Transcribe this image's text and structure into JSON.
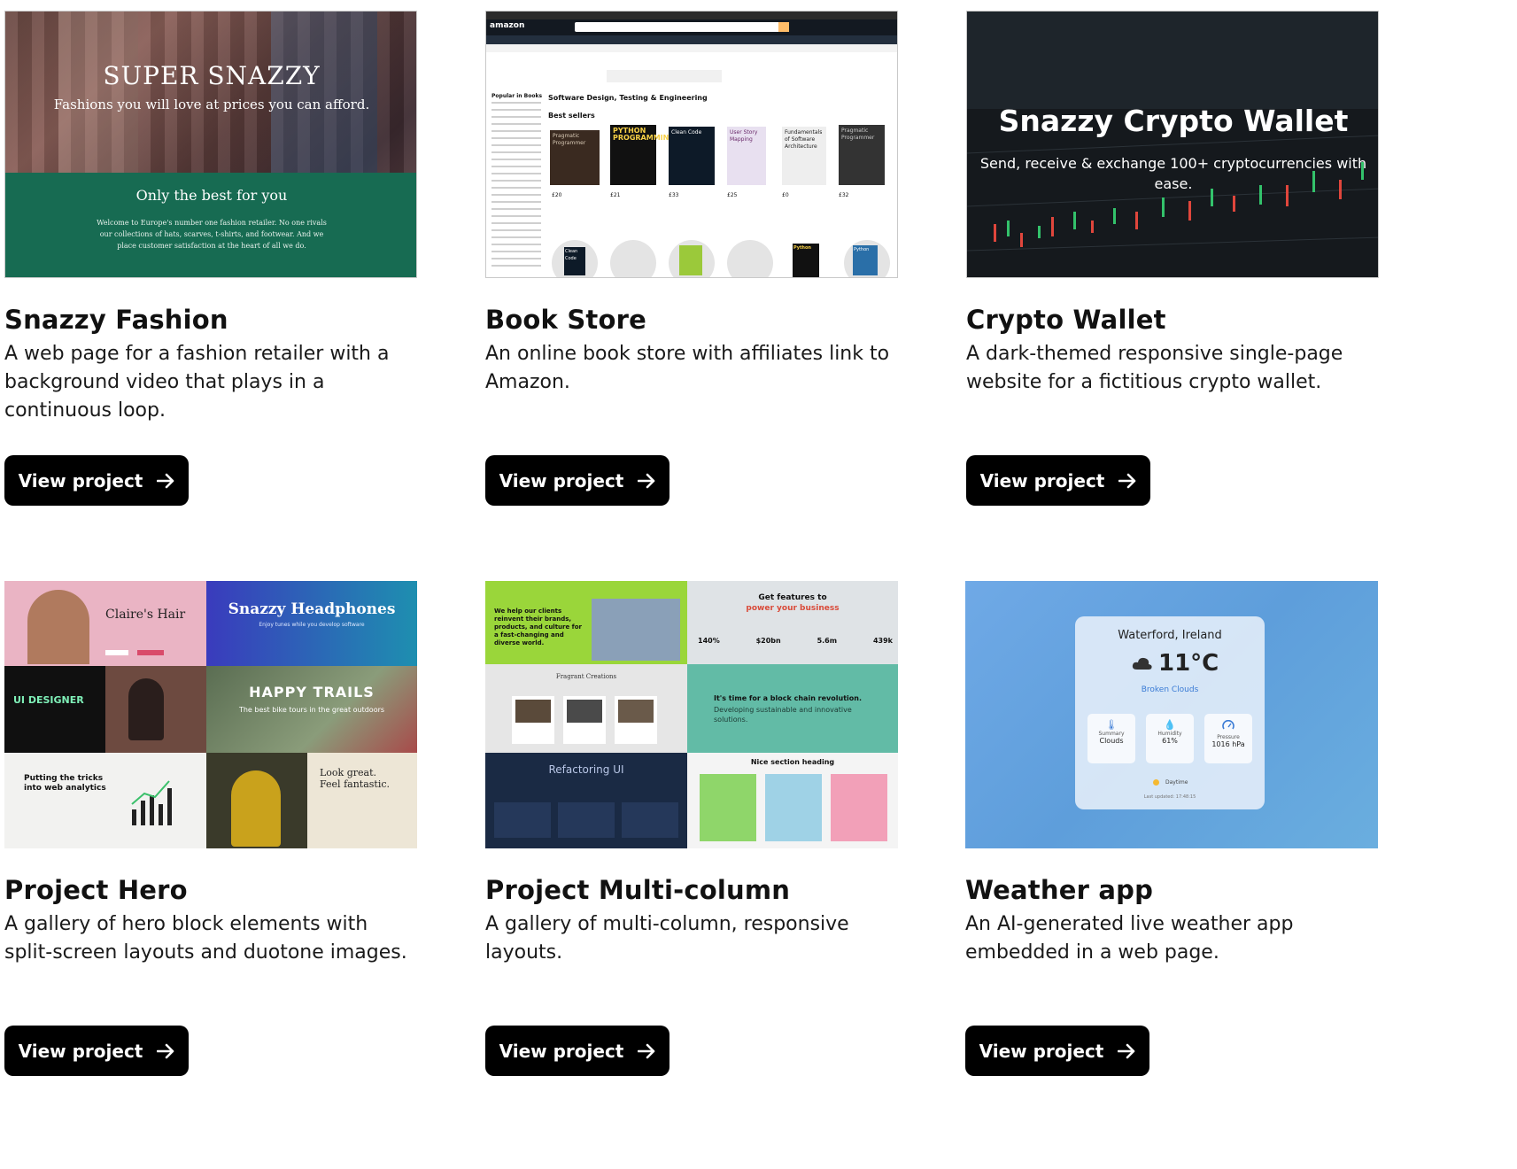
{
  "view_project_label": "View project",
  "cards": [
    {
      "title": "Snazzy Fashion",
      "description": "A web page for a fashion retailer with a background video that plays in a continuous loop.",
      "thumb": {
        "headline": "SUPER SNAZZY",
        "tagline": "Fashions you will love at prices you can afford.",
        "section_title": "Only the best for you",
        "section_text": "Welcome to Europe's number one fashion retailer. No one rivals our collections of hats, scarves, t-shirts, and footwear. And we place customer satisfaction at the heart of all we do."
      }
    },
    {
      "title": "Book Store",
      "description": "An online book store with affiliates link to Amazon.",
      "thumb": {
        "logo": "amazon",
        "section": "Software Design, Testing & Engineering",
        "bestsellers": "Best sellers",
        "sidebar_heading": "Popular in Books",
        "books": [
          {
            "cover": "Pragmatic Programmer",
            "price": "£20",
            "color": "#3a2a20"
          },
          {
            "cover": "PYTHON PROGRAMMING",
            "price": "£21",
            "color": "#111111"
          },
          {
            "cover": "Clean Code",
            "price": "£33",
            "color": "#0d1a28"
          },
          {
            "cover": "User Story Mapping",
            "price": "£25",
            "color": "#e8e0f0"
          },
          {
            "cover": "Fundamentals of Software Architecture",
            "price": "£0",
            "color": "#eeeeee"
          },
          {
            "cover": "Pragmatic Programmer",
            "price": "£32",
            "color": "#333333"
          }
        ],
        "bottom_covers": [
          "Clean Code",
          "Python",
          "Python"
        ]
      }
    },
    {
      "title": "Crypto Wallet",
      "description": "A dark-themed responsive single-page website for a fictitious crypto wallet.",
      "thumb": {
        "headline": "Snazzy Crypto Wallet",
        "tagline": "Send, receive & exchange 100+ cryptocurrencies with ease."
      }
    },
    {
      "title": "Project Hero",
      "description": "A gallery of hero block elements with split-screen layouts and duotone images.",
      "thumb": {
        "tiles": {
          "hair_title": "Claire's Hair",
          "headphones_title": "Snazzy Headphones",
          "headphones_sub": "Enjoy tunes while you develop software",
          "designer_title": "UI DESIGNER",
          "trails_title": "HAPPY TRAILS",
          "trails_sub": "The best bike tours in the great outdoors",
          "analytics_title": "Putting the tricks into web analytics",
          "fashion_title": "Look great. Feel fantastic."
        }
      }
    },
    {
      "title": "Project Multi-column",
      "description": "A gallery of multi-column, responsive layouts.",
      "thumb": {
        "tiles": {
          "green_text": "We help our clients reinvent their brands, products, and culture for a fast-changing and diverse world.",
          "features_title": "Get features to",
          "features_accent": "power your business",
          "stats": [
            "140%",
            "$20bn",
            "5.6m",
            "439k"
          ],
          "fragrant_title": "Fragrant Creations",
          "blockchain_title": "It's time for a block chain revolution.",
          "blockchain_sub": "Developing sustainable and innovative solutions.",
          "refactoring_title": "Refactoring UI",
          "nice_heading": "Nice section heading"
        }
      }
    },
    {
      "title": "Weather app",
      "description": "An AI-generated live weather app embedded in a web page.",
      "thumb": {
        "location": "Waterford, Ireland",
        "temperature": "11°C",
        "condition": "Broken Clouds",
        "stats": [
          {
            "label": "Summary",
            "value": "Clouds",
            "icon": "thermometer-icon"
          },
          {
            "label": "Humidity",
            "value": "61%",
            "icon": "droplet-icon"
          },
          {
            "label": "Pressure",
            "value": "1016 hPa",
            "icon": "gauge-icon"
          }
        ],
        "daytime": "Daytime",
        "updated": "Last updated: 17:48:15"
      }
    }
  ]
}
